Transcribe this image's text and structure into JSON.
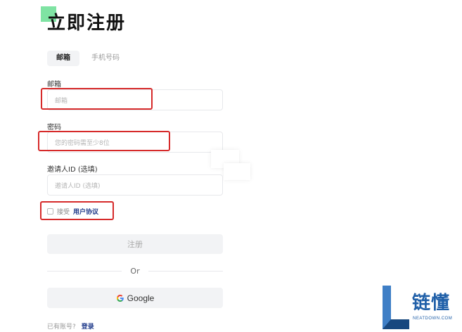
{
  "page": {
    "title": "立即注册"
  },
  "tabs": [
    {
      "label": "邮箱",
      "active": true
    },
    {
      "label": "手机号码",
      "active": false
    }
  ],
  "email": {
    "label": "邮箱",
    "placeholder": "邮箱"
  },
  "password": {
    "label": "密码",
    "placeholder": "您的密码需至少8位"
  },
  "referral": {
    "label": "邀请人ID (选填)",
    "placeholder": "邀请人ID (选填)"
  },
  "agreement": {
    "prefix": "接受",
    "link": "用户协议",
    "checked": false
  },
  "register": {
    "label": "注册"
  },
  "divider": {
    "label": "Or"
  },
  "google": {
    "label": "Google",
    "icon": "google-icon"
  },
  "login": {
    "prompt": "已有账号?",
    "link": "登录"
  },
  "watermark": {
    "name": "链懂",
    "domain": "NEATDOWN.COM"
  },
  "colors": {
    "accent_square": "#7fe3a3",
    "highlight_box": "#d62a2a",
    "link": "#1f3a8a",
    "button_bg": "#f2f3f5"
  }
}
